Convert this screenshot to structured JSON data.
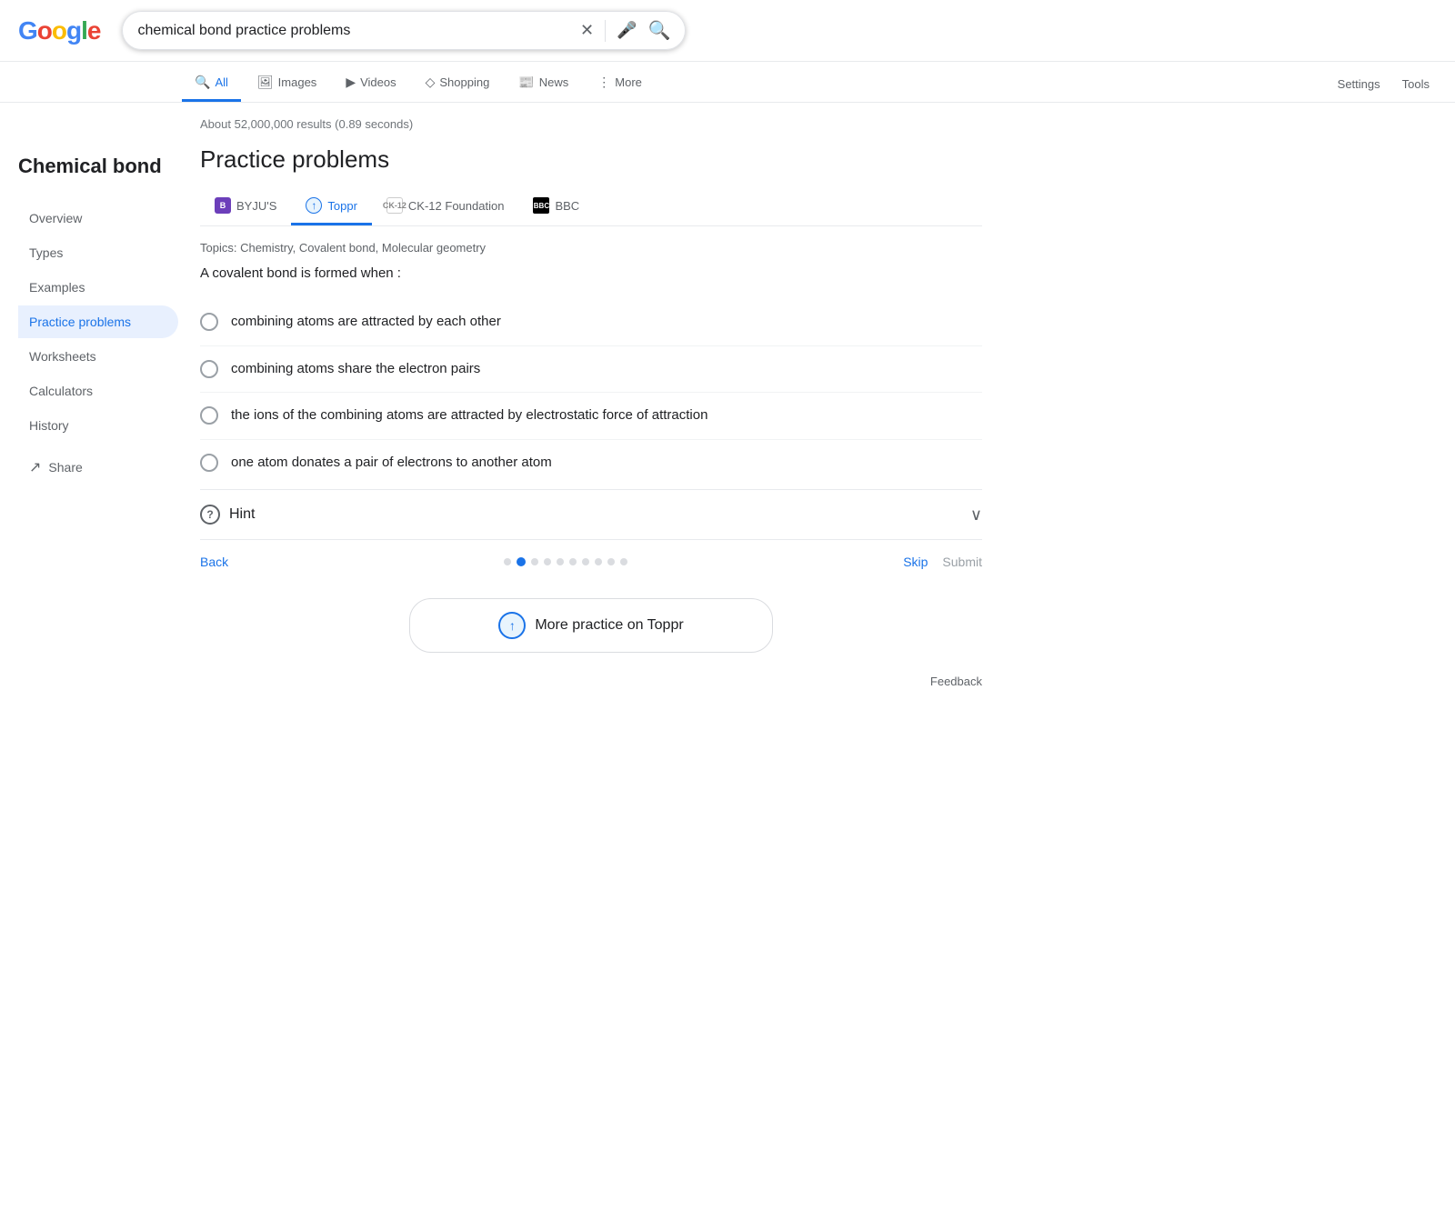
{
  "header": {
    "logo_letters": [
      "G",
      "o",
      "o",
      "g",
      "l",
      "e"
    ],
    "search_value": "chemical bond practice problems",
    "clear_label": "✕",
    "mic_label": "🎤",
    "search_label": "🔍"
  },
  "nav": {
    "tabs": [
      {
        "id": "all",
        "label": "All",
        "icon": "🔍",
        "active": true
      },
      {
        "id": "images",
        "label": "Images",
        "icon": "🖼"
      },
      {
        "id": "videos",
        "label": "Videos",
        "icon": "▶"
      },
      {
        "id": "shopping",
        "label": "Shopping",
        "icon": "◇"
      },
      {
        "id": "news",
        "label": "News",
        "icon": "📰"
      },
      {
        "id": "more",
        "label": "More",
        "icon": "⋮"
      }
    ],
    "settings_label": "Settings",
    "tools_label": "Tools"
  },
  "sidebar": {
    "title": "Chemical bond",
    "items": [
      {
        "label": "Overview",
        "active": false
      },
      {
        "label": "Types",
        "active": false
      },
      {
        "label": "Examples",
        "active": false
      },
      {
        "label": "Practice problems",
        "active": true
      },
      {
        "label": "Worksheets",
        "active": false
      },
      {
        "label": "Calculators",
        "active": false
      },
      {
        "label": "History",
        "active": false
      }
    ],
    "share_label": "Share",
    "share_icon": "↗"
  },
  "results": {
    "count_text": "About 52,000,000 results (0.89 seconds)"
  },
  "quiz": {
    "section_title": "Practice problems",
    "sources": [
      {
        "label": "BYJU'S",
        "icon_text": "B",
        "active": false
      },
      {
        "label": "Toppr",
        "icon_text": "↑",
        "active": true
      },
      {
        "label": "CK-12 Foundation",
        "icon_text": "CK-12",
        "active": false
      },
      {
        "label": "BBC",
        "icon_text": "BBC",
        "active": false
      }
    ],
    "topics_label": "Topics: Chemistry, Covalent bond, Molecular geometry",
    "question": "A covalent bond is formed when :",
    "options": [
      {
        "text": "combining atoms are attracted by each other"
      },
      {
        "text": "combining atoms share the electron pairs"
      },
      {
        "text": "the ions of the combining atoms are attracted by electrostatic force of attraction"
      },
      {
        "text": "one atom donates a pair of electrons to another atom"
      }
    ],
    "hint_label": "Hint",
    "back_label": "Back",
    "skip_label": "Skip",
    "submit_label": "Submit",
    "dots": [
      {
        "active": false
      },
      {
        "active": true
      },
      {
        "active": false
      },
      {
        "active": false
      },
      {
        "active": false
      },
      {
        "active": false
      },
      {
        "active": false
      },
      {
        "active": false
      },
      {
        "active": false
      },
      {
        "active": false
      }
    ],
    "more_practice_label": "More practice on Toppr"
  },
  "feedback": {
    "label": "Feedback"
  }
}
